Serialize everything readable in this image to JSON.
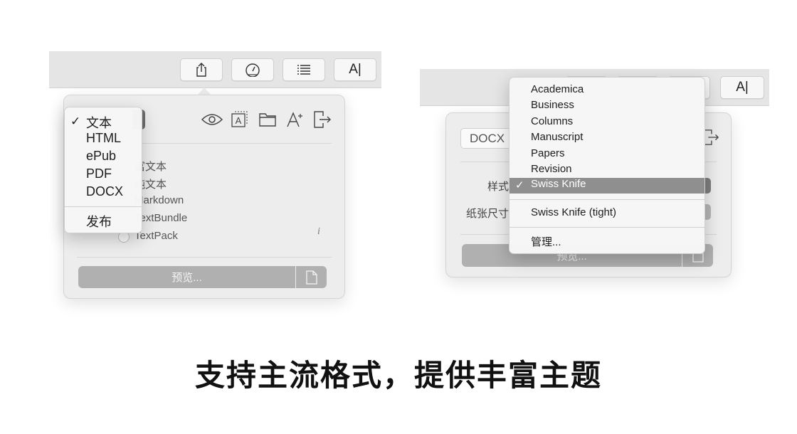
{
  "left": {
    "toolbar": {
      "buttons": [
        {
          "name": "share-icon"
        },
        {
          "name": "gauge-icon"
        },
        {
          "name": "list-icon"
        },
        {
          "name": "font-icon",
          "label": "A|"
        }
      ]
    },
    "panel": {
      "icons": [
        "eye-icon",
        "text-box-icon",
        "folder-icon",
        "font-style-icon",
        "export-icon"
      ],
      "options": [
        "富文本",
        "纯文本",
        "Markdown",
        "TextBundle",
        "TextPack"
      ],
      "info_label": "i",
      "preview_label": "预览..."
    },
    "format_menu": {
      "checkmark": "✓",
      "items": [
        "文本",
        "HTML",
        "ePub",
        "PDF",
        "DOCX"
      ],
      "selected": "文本",
      "publish_label": "发布"
    }
  },
  "right": {
    "toolbar": {
      "font_button_label": "A|"
    },
    "panel": {
      "format_value": "DOCX",
      "style_label": "样式",
      "paper_size_label": "纸张尺寸",
      "preview_label": "预览..."
    },
    "theme_menu": {
      "checkmark": "✓",
      "items": [
        "Academica",
        "Business",
        "Columns",
        "Manuscript",
        "Papers",
        "Revision",
        "Swiss Knife"
      ],
      "selected": "Swiss Knife",
      "extra_item": "Swiss Knife (tight)",
      "manage_label": "管理..."
    }
  },
  "headline": "支持主流格式，提供丰富主题",
  "colors": {
    "toolbar": "#e5e5e5",
    "panel": "#ededed",
    "preview_button": "#b0b0b0",
    "menu_highlight": "#8f8f8f"
  }
}
